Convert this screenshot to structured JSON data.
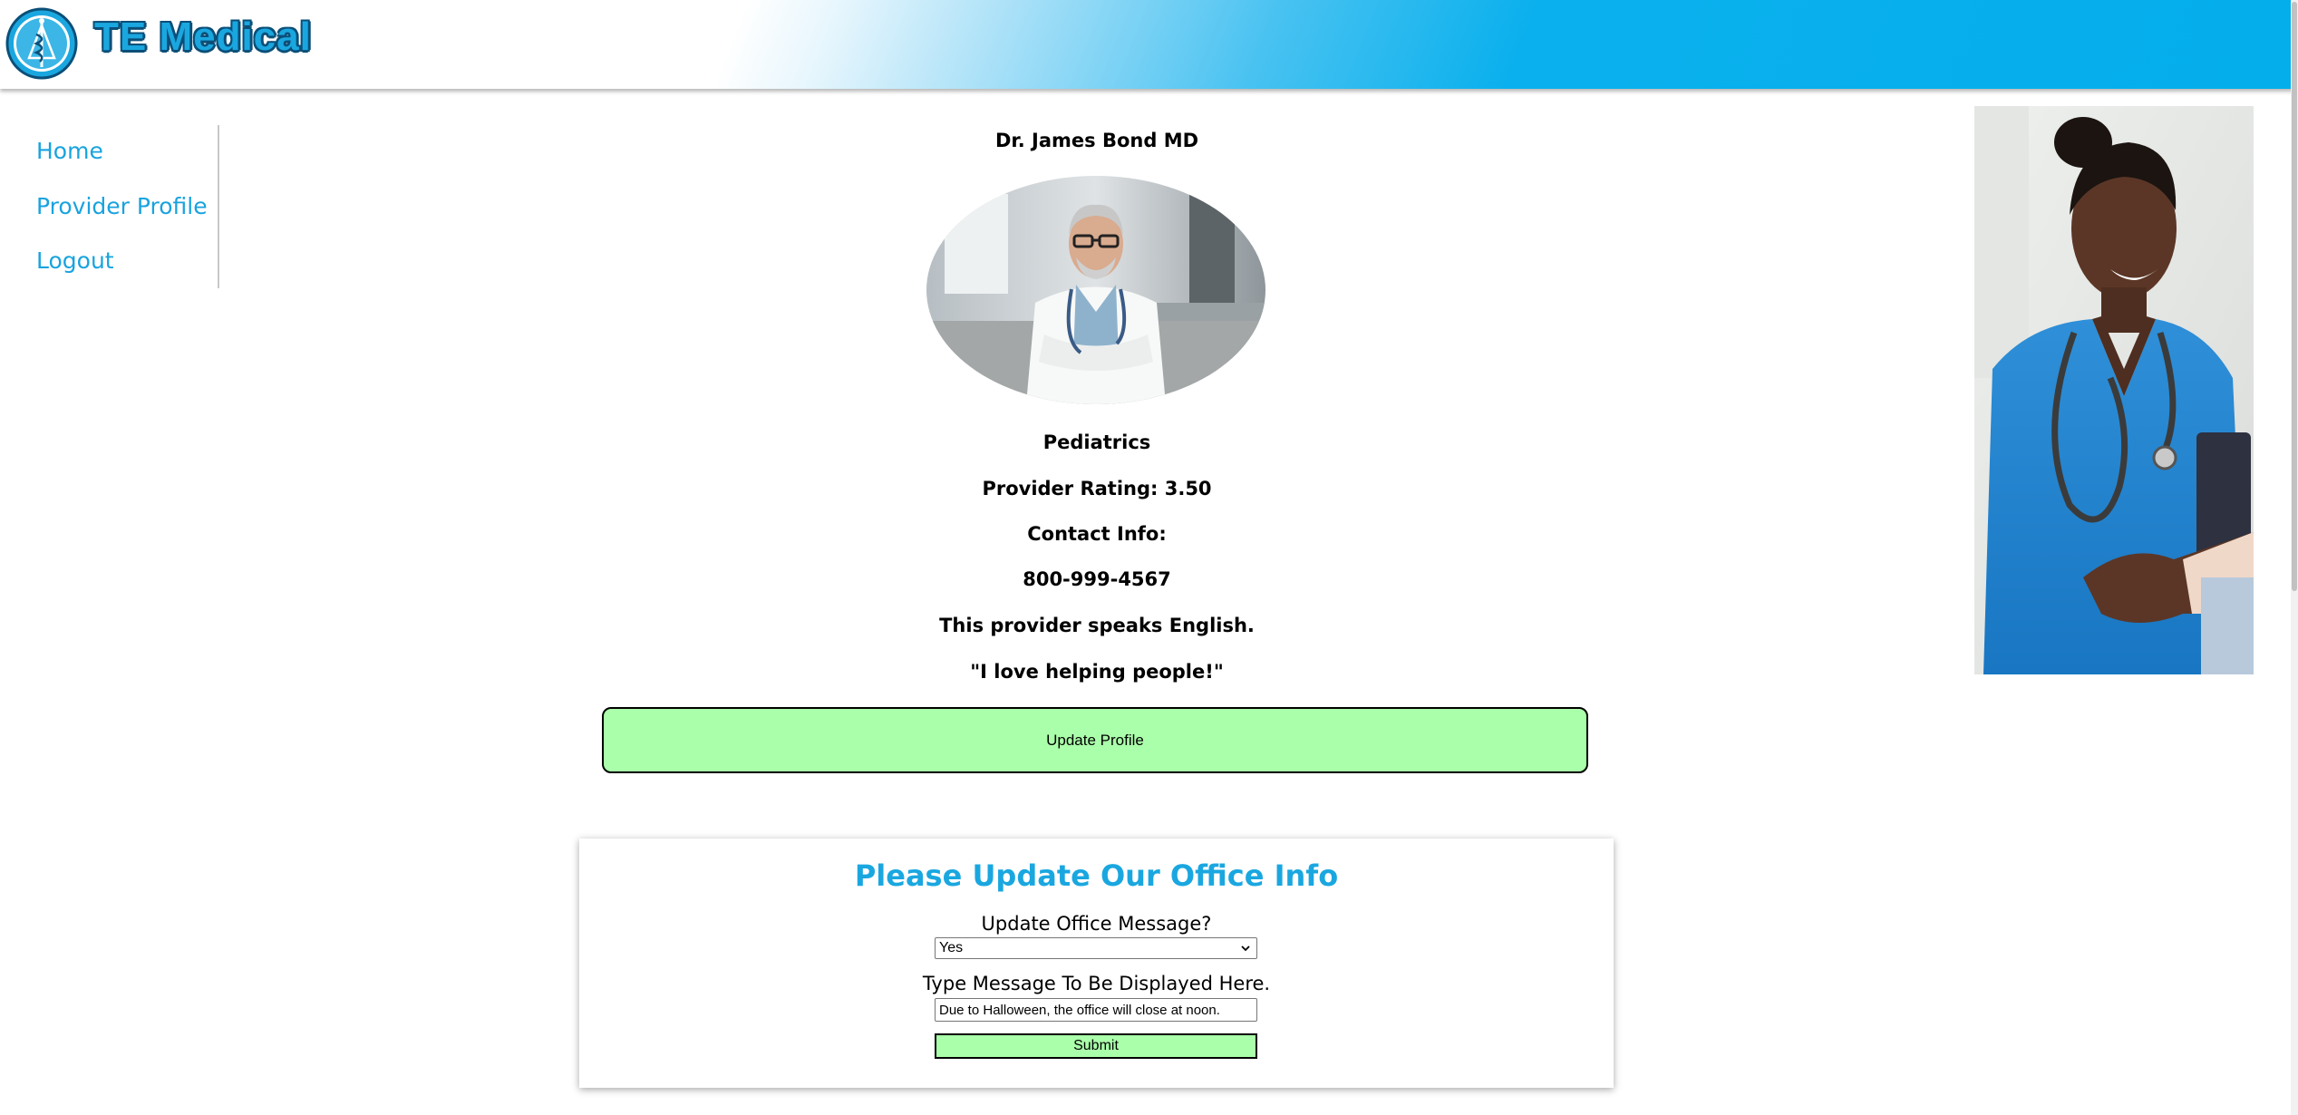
{
  "header": {
    "brand": "TE Medical",
    "logo_icon": "caduceus-icon",
    "accent_color": "#04aeeb"
  },
  "sidebar": {
    "items": [
      {
        "label": "Home"
      },
      {
        "label": "Provider Profile"
      },
      {
        "label": "Logout"
      }
    ],
    "link_color": "#19a3de"
  },
  "profile": {
    "name": "Dr. James Bond MD",
    "photo_icon": "doctor-portrait-photo",
    "specialty": "Pediatrics",
    "rating": "Provider Rating: 3.50",
    "contact_label": "Contact Info:",
    "phone": "800-999-4567",
    "language": "This provider speaks English.",
    "quote": "\"I love helping people!\"",
    "update_button": "Update Profile",
    "button_color": "#aaffaa"
  },
  "office_form": {
    "title": "Please Update Our Office Info",
    "message_question": "Update Office Message?",
    "message_select_value": "Yes",
    "message_prompt": "Type Message To Be Displayed Here.",
    "message_value": "Due to Halloween, the office will close at noon.",
    "submit": "Submit"
  },
  "side_image": {
    "icon": "nurse-handshake-photo"
  }
}
